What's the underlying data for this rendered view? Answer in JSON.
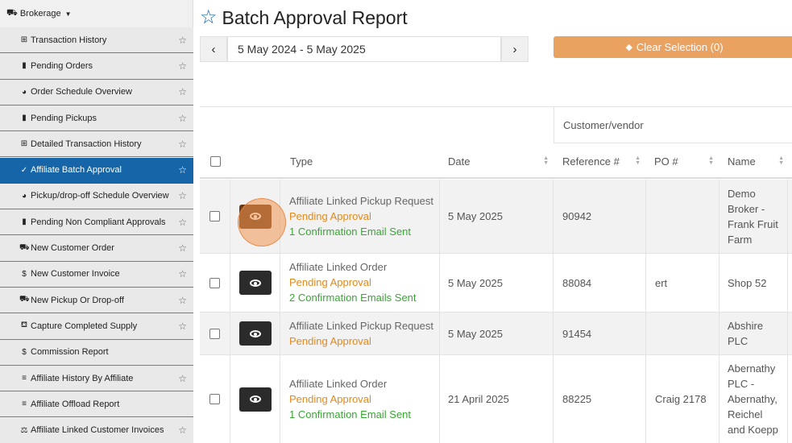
{
  "sidebar": {
    "brand": "Brokerage",
    "items": [
      {
        "label": "Transaction History",
        "icon": "table-icon",
        "glyph": "⊞",
        "star": true,
        "active": false
      },
      {
        "label": "Pending Orders",
        "icon": "clipboard-icon",
        "glyph": "▮",
        "star": true,
        "active": false
      },
      {
        "label": "Order Schedule Overview",
        "icon": "clock-icon",
        "glyph": "◕",
        "star": true,
        "active": false
      },
      {
        "label": "Pending Pickups",
        "icon": "clipboard-icon",
        "glyph": "▮",
        "star": true,
        "active": false
      },
      {
        "label": "Detailed Transaction History",
        "icon": "table-icon",
        "glyph": "⊞",
        "star": true,
        "active": false
      },
      {
        "label": "Affiliate Batch Approval",
        "icon": "check-icon",
        "glyph": "✓",
        "star": true,
        "active": true
      },
      {
        "label": "Pickup/drop-off Schedule Overview",
        "icon": "clock-icon",
        "glyph": "◕",
        "star": true,
        "active": false
      },
      {
        "label": "Pending Non Compliant Approvals",
        "icon": "clipboard-icon",
        "glyph": "▮",
        "star": true,
        "active": false
      },
      {
        "label": "New Customer Order",
        "icon": "truck-icon",
        "glyph": "⛟",
        "star": true,
        "active": false
      },
      {
        "label": "New Customer Invoice",
        "icon": "dollar-icon",
        "glyph": "$",
        "star": true,
        "active": false
      },
      {
        "label": "New Pickup Or Drop-off",
        "icon": "truck-icon",
        "glyph": "⛟",
        "star": true,
        "active": false
      },
      {
        "label": "Capture Completed Supply",
        "icon": "supply-icon",
        "glyph": "⛾",
        "star": true,
        "active": false
      },
      {
        "label": "Commission Report",
        "icon": "dollar-icon",
        "glyph": "$",
        "star": false,
        "active": false
      },
      {
        "label": "Affiliate History By Affiliate",
        "icon": "chart-icon",
        "glyph": "≡",
        "star": true,
        "active": false
      },
      {
        "label": "Affiliate Offload Report",
        "icon": "chart-icon",
        "glyph": "≡",
        "star": false,
        "active": false
      },
      {
        "label": "Affiliate Linked Customer Invoices",
        "icon": "balance-icon",
        "glyph": "⚖",
        "star": true,
        "active": false
      }
    ]
  },
  "page": {
    "title": "Batch Approval Report",
    "date_range": "5 May 2024 - 5 May 2025",
    "clear_selection": "Clear Selection (0)"
  },
  "table": {
    "group_header": "Customer/vendor",
    "headers": {
      "type": "Type",
      "date": "Date",
      "reference": "Reference #",
      "po": "PO #",
      "name": "Name"
    },
    "rows": [
      {
        "type": "Affiliate Linked Pickup Request",
        "status": "Pending Approval",
        "emails": "1 Confirmation Email Sent",
        "date": "5 May 2025",
        "reference": "90942",
        "po": "",
        "name_lines": [
          "Demo",
          "Broker -",
          "Frank Fruit",
          "Farm"
        ]
      },
      {
        "type": "Affiliate Linked Order",
        "status": "Pending Approval",
        "emails": "2 Confirmation Emails Sent",
        "date": "5 May 2025",
        "reference": "88084",
        "po": "ert",
        "name_lines": [
          "Shop 52"
        ]
      },
      {
        "type": "Affiliate Linked Pickup Request",
        "status": "Pending Approval",
        "emails": "",
        "date": "5 May 2025",
        "reference": "91454",
        "po": "",
        "name_lines": [
          "Abshire",
          "PLC"
        ]
      },
      {
        "type": "Affiliate Linked Order",
        "status": "Pending Approval",
        "emails": "1 Confirmation Email Sent",
        "date": "21 April 2025",
        "reference": "88225",
        "po": "Craig 2178",
        "name_lines": [
          "Abernathy",
          "PLC -",
          "Abernathy,",
          "Reichel",
          "and Koepp"
        ]
      }
    ]
  }
}
